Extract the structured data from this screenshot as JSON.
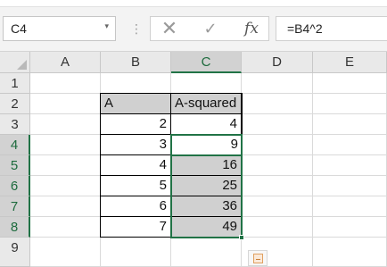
{
  "formula_bar": {
    "name_box": "C4",
    "name_box_arrow": "▾",
    "separator": "⋮",
    "cancel_icon": "✕",
    "enter_icon": "✓",
    "fx_label": "fx",
    "formula": "=B4^2"
  },
  "columns": [
    "A",
    "B",
    "C",
    "D",
    "E"
  ],
  "rows": [
    "1",
    "2",
    "3",
    "4",
    "5",
    "6",
    "7",
    "8",
    "9"
  ],
  "table": {
    "header_a": "A",
    "header_b": "A-squared",
    "data": [
      {
        "a": "2",
        "b": "4"
      },
      {
        "a": "3",
        "b": "9"
      },
      {
        "a": "4",
        "b": "16"
      },
      {
        "a": "5",
        "b": "25"
      },
      {
        "a": "6",
        "b": "36"
      },
      {
        "a": "7",
        "b": "49"
      }
    ]
  },
  "selection": {
    "active_cell": "C4",
    "range": "C4:C8"
  },
  "colors": {
    "accent": "#217346",
    "header_bg": "#e9e9e9",
    "selected_fill": "#d0d0d0"
  }
}
